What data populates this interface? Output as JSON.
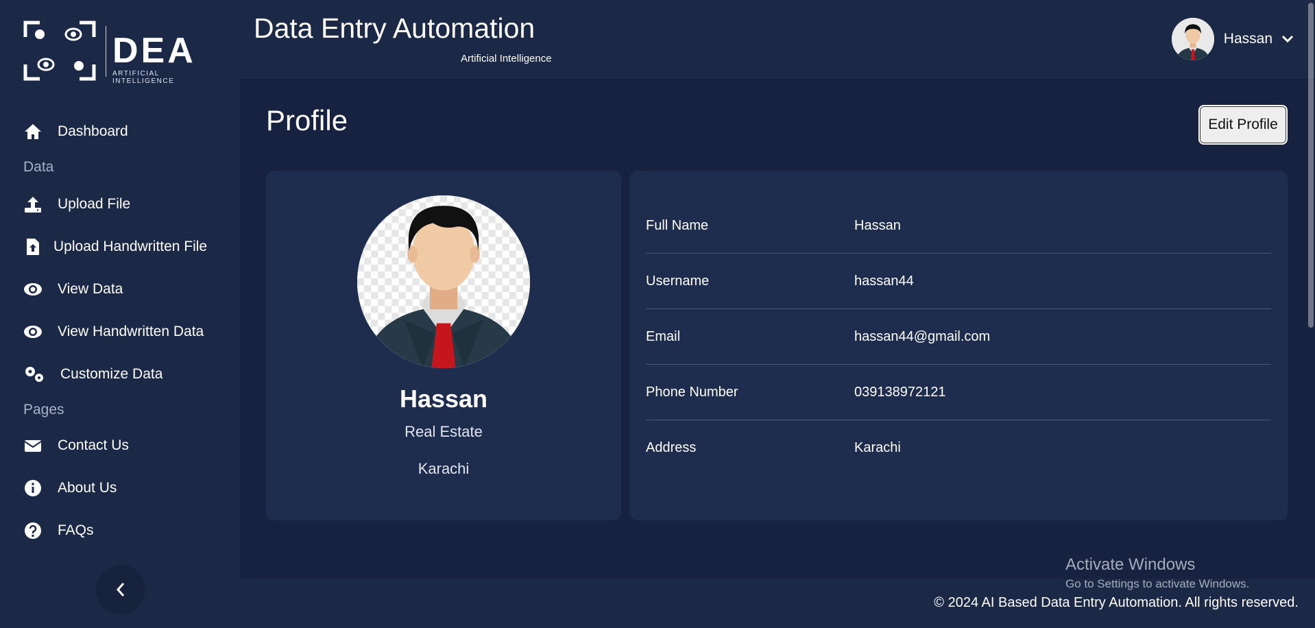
{
  "app": {
    "logo_text": "DEA",
    "logo_subtext": "ARTIFICIAL INTELLIGENCE",
    "title": "Data Entry Automation",
    "subtitle": "Artificial Intelligence"
  },
  "user": {
    "name": "Hassan"
  },
  "sidebar": {
    "items": [
      {
        "label": "Dashboard",
        "icon": "home-icon"
      },
      {
        "label": "Upload File",
        "icon": "upload-icon"
      },
      {
        "label": "Upload Handwritten File",
        "icon": "file-upload-icon"
      },
      {
        "label": "View Data",
        "icon": "eye-icon"
      },
      {
        "label": "View Handwritten Data",
        "icon": "eye-icon"
      },
      {
        "label": "Customize Data",
        "icon": "gears-icon"
      },
      {
        "label": "Contact Us",
        "icon": "envelope-icon"
      },
      {
        "label": "About Us",
        "icon": "info-icon"
      },
      {
        "label": "FAQs",
        "icon": "question-icon"
      }
    ],
    "sections": [
      "Data",
      "Pages"
    ]
  },
  "page": {
    "title": "Profile",
    "edit_button": "Edit Profile"
  },
  "profile": {
    "name": "Hassan",
    "role": "Real Estate",
    "city": "Karachi"
  },
  "details": [
    {
      "label": "Full Name",
      "value": "Hassan"
    },
    {
      "label": "Username",
      "value": "hassan44"
    },
    {
      "label": "Email",
      "value": "hassan44@gmail.com"
    },
    {
      "label": "Phone Number",
      "value": "039138972121"
    },
    {
      "label": "Address",
      "value": "Karachi"
    }
  ],
  "footer": {
    "text": "© 2024 AI Based Data Entry Automation. All rights reserved."
  },
  "watermark": {
    "line1": "Activate Windows",
    "line2": "Go to Settings to activate Windows."
  }
}
